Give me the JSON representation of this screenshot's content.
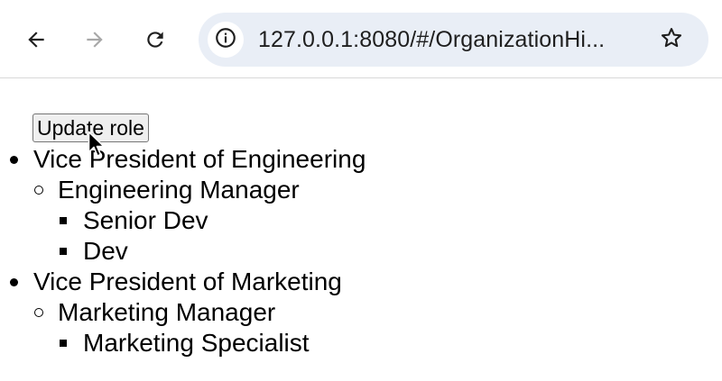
{
  "browser": {
    "url": "127.0.0.1:8080/#/OrganizationHi...",
    "back_icon": "arrow-left-icon",
    "forward_icon": "arrow-right-icon",
    "reload_icon": "reload-icon",
    "site_info_icon": "info-icon",
    "bookmark_icon": "star-icon"
  },
  "page": {
    "update_button_label": "Update role",
    "hierarchy": [
      {
        "label": "Vice President of Engineering",
        "children": [
          {
            "label": "Engineering Manager",
            "children": [
              {
                "label": "Senior Dev"
              },
              {
                "label": "Dev"
              }
            ]
          }
        ]
      },
      {
        "label": "Vice President of Marketing",
        "children": [
          {
            "label": "Marketing Manager",
            "children": [
              {
                "label": "Marketing Specialist"
              }
            ]
          }
        ]
      }
    ]
  },
  "colors": {
    "toolbar_bg": "#ffffff",
    "omnibox_bg": "#e9eef6",
    "button_bg": "#efefef",
    "button_border": "#767676",
    "icon_active": "#1f1f1f",
    "icon_disabled": "#a8a8a8"
  }
}
